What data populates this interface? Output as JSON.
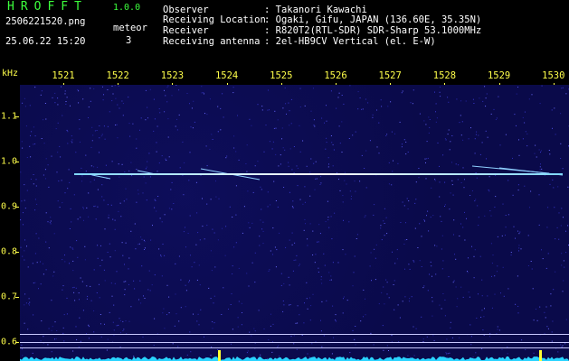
{
  "header": {
    "app_title": "HROFFT",
    "app_version": "1.0.0",
    "filename": "2506221520.png",
    "datetime": "25.06.22 15:20",
    "meteor_label": "meteor",
    "meteor_count": "3",
    "info": [
      {
        "label": "Observer",
        "value": ": Takanori Kawachi"
      },
      {
        "label": "Receiving Location",
        "value": ": Ogaki, Gifu, JAPAN (136.60E, 35.35N)"
      },
      {
        "label": "Receiver",
        "value": ": R820T2(RTL-SDR) SDR-Sharp 53.1000MHz"
      },
      {
        "label": "Receiving antenna",
        "value": ": 2el-HB9CV Vertical (el. E-W)"
      }
    ]
  },
  "x_axis": {
    "unit": "kHz",
    "ticks": [
      "1521",
      "1522",
      "1523",
      "1524",
      "1525",
      "1526",
      "1527",
      "1528",
      "1529",
      "1530"
    ]
  },
  "y_axis": {
    "ticks": [
      "1.1",
      "1.0",
      "0.9",
      "0.8",
      "0.7",
      "0.6"
    ]
  },
  "colors": {
    "header_green": "#3cff3c",
    "label_yellow": "#ffff4a",
    "background": "#0a0a4a",
    "spectrum": "#2ad4ff",
    "marker": "#ffff30"
  }
}
